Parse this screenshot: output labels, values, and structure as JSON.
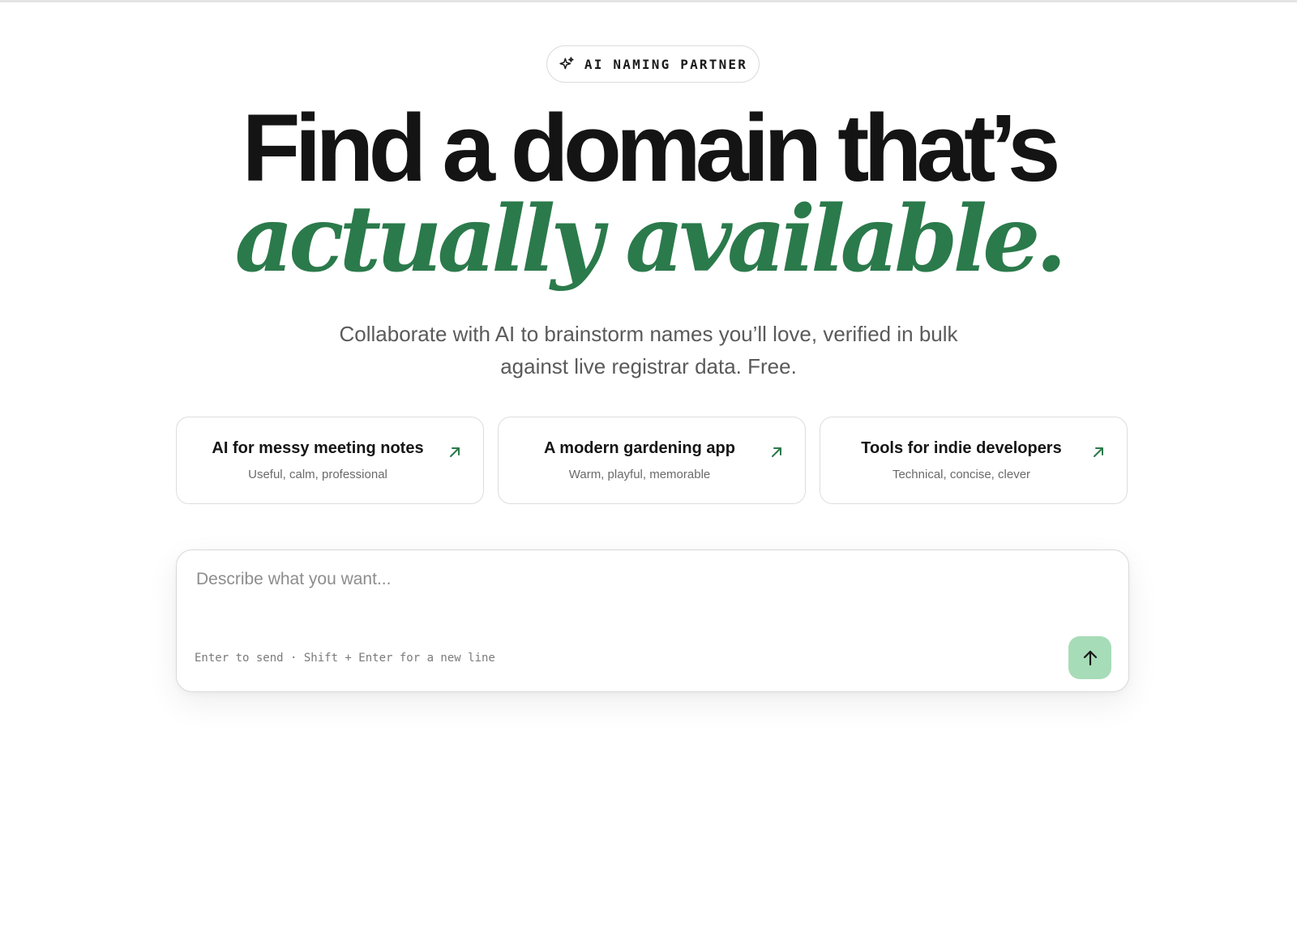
{
  "badge": {
    "icon": "sparkle-icon",
    "label": "AI NAMING PARTNER"
  },
  "hero": {
    "line1": "Find a domain that’s",
    "line2": "actually available.",
    "subtitle": "Collaborate with AI to brainstorm names you’ll love, verified in bulk against live registrar data. Free.",
    "accent_color": "#2b7a4b"
  },
  "suggestions": [
    {
      "title": "AI for messy meeting notes",
      "subtitle": "Useful, calm, professional",
      "icon": "arrow-up-right-icon"
    },
    {
      "title": "A modern gardening app",
      "subtitle": "Warm, playful, memorable",
      "icon": "arrow-up-right-icon"
    },
    {
      "title": "Tools for indie developers",
      "subtitle": "Technical, concise, clever",
      "icon": "arrow-up-right-icon"
    }
  ],
  "composer": {
    "placeholder": "Describe what you want...",
    "value": "",
    "hint": "Enter to send · Shift + Enter for a new line",
    "send_icon": "arrow-up-icon",
    "send_color": "#a7dcb8"
  }
}
